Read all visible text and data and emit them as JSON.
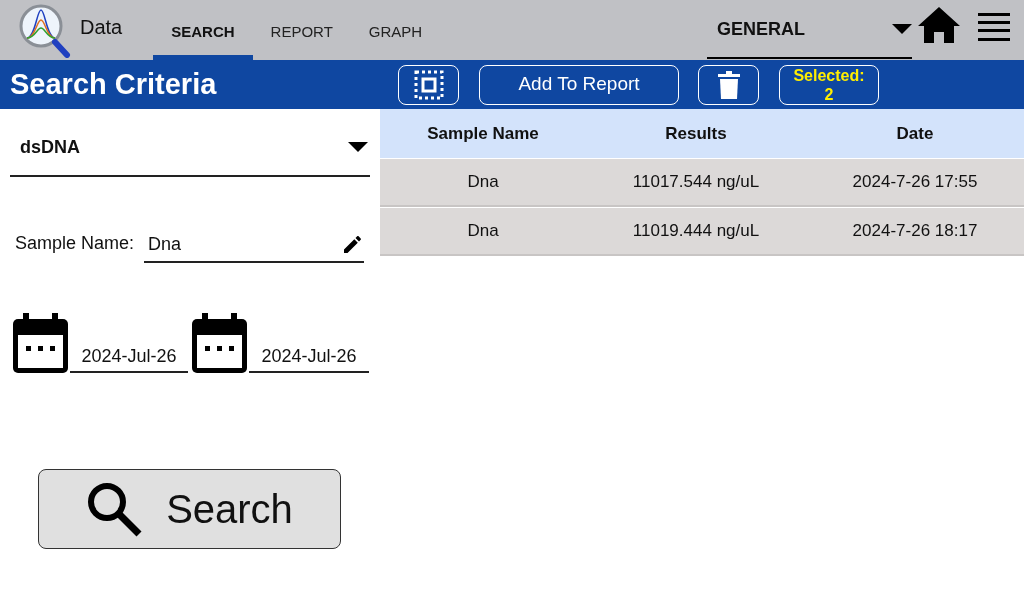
{
  "app": {
    "title": "Data"
  },
  "tabs": [
    {
      "label": "SEARCH",
      "selected": true
    },
    {
      "label": "REPORT",
      "selected": false
    },
    {
      "label": "GRAPH",
      "selected": false
    }
  ],
  "profile_dropdown": {
    "value": "GENERAL"
  },
  "toolbar": {
    "title": "Search Criteria",
    "add_button": "Add To Report",
    "selected_label": "Selected:",
    "selected_count": "2"
  },
  "criteria": {
    "assay_dropdown": {
      "value": "dsDNA"
    },
    "sample_name": {
      "label": "Sample Name:",
      "value": "Dna"
    },
    "start_date": "2024-Jul-26",
    "end_date": "2024-Jul-26",
    "search_button": "Search"
  },
  "table": {
    "columns": [
      "Sample Name",
      "Results",
      "Date"
    ],
    "rows": [
      [
        "Dna",
        "11017.544 ng/uL",
        "2024-7-26 17:55"
      ],
      [
        "Dna",
        "11019.444 ng/uL",
        "2024-7-26 18:17"
      ]
    ]
  }
}
